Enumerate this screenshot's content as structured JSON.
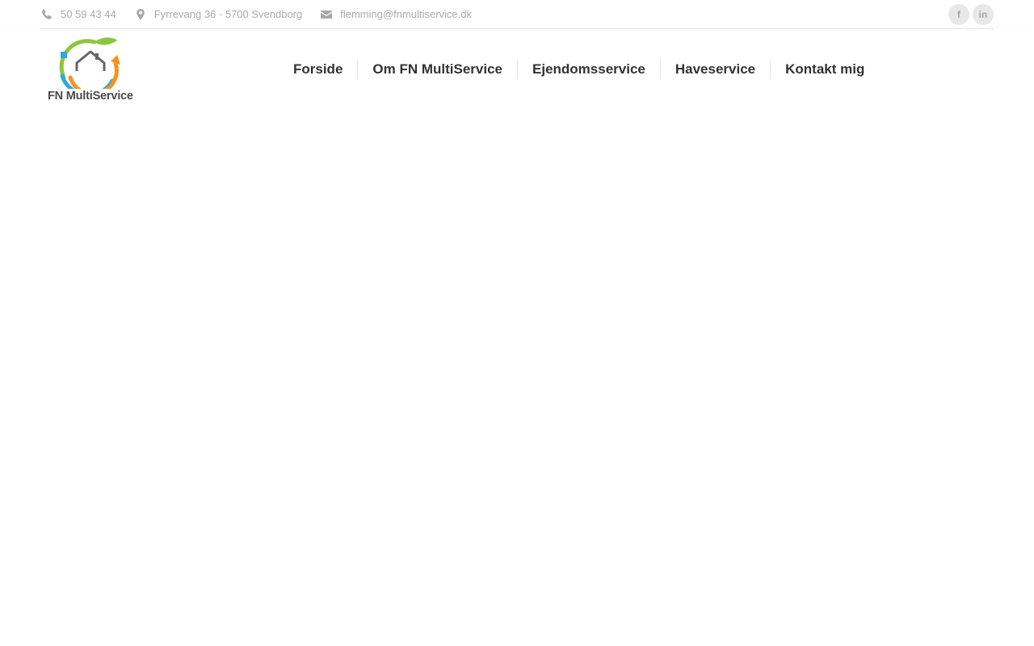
{
  "topbar": {
    "phone": "50 59 43 44",
    "address": "Fyrrevang 36 · 5700 Svendborg",
    "email": "flemming@fnmultiservice.dk",
    "phone_icon": "phone-icon",
    "address_icon": "map-pin-icon",
    "email_icon": "mail-icon",
    "social": [
      {
        "icon": "facebook-icon",
        "glyph": "f"
      },
      {
        "icon": "linkedin-icon",
        "glyph": "in"
      }
    ]
  },
  "logo": {
    "text": "FN MultiService",
    "colors": {
      "green": "#8cc63f",
      "blue": "#29abe2",
      "orange": "#f7931e",
      "house": "#666666"
    }
  },
  "nav": {
    "items": [
      {
        "label": "Forside"
      },
      {
        "label": "Om FN MultiService"
      },
      {
        "label": "Ejendomsservice"
      },
      {
        "label": "Haveservice"
      },
      {
        "label": "Kontakt mig"
      }
    ]
  }
}
